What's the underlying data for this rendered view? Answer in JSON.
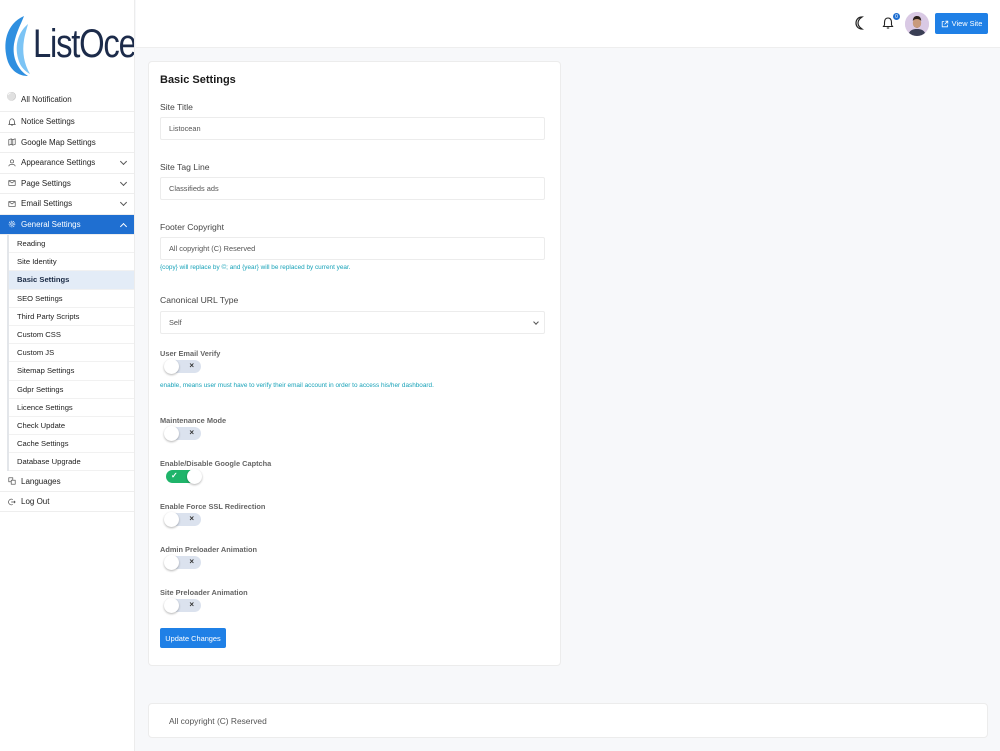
{
  "brand": {
    "name": "ListOcean"
  },
  "sidebar": {
    "items": [
      {
        "label": "All Notification",
        "icon": "bell-icon"
      },
      {
        "label": "Notice Settings",
        "icon": "bell-icon"
      },
      {
        "label": "Google Map Settings",
        "icon": "map-icon"
      },
      {
        "label": "Appearance Settings",
        "icon": "people-icon"
      },
      {
        "label": "Page Settings",
        "icon": "mail-icon"
      },
      {
        "label": "Email Settings",
        "icon": "mail-icon"
      },
      {
        "label": "General Settings",
        "icon": "gear-icon"
      }
    ],
    "submenu": [
      "Reading",
      "Site Identity",
      "Basic Settings",
      "SEO Settings",
      "Third Party Scripts",
      "Custom CSS",
      "Custom JS",
      "Sitemap Settings",
      "Gdpr Settings",
      "Licence Settings",
      "Check Update",
      "Cache Settings",
      "Database Upgrade"
    ],
    "bottom": [
      {
        "label": "Languages",
        "icon": "language-icon"
      },
      {
        "label": "Log Out",
        "icon": "logout-icon"
      }
    ]
  },
  "topbar": {
    "notification_count": "0",
    "view_site_label": "View Site"
  },
  "card": {
    "title": "Basic Settings",
    "site_title_label": "Site Title",
    "site_title_value": "Listocean",
    "tag_line_label": "Site Tag Line",
    "tag_line_value": "Classifieds ads",
    "footer_copyright_label": "Footer Copyright",
    "footer_copyright_value": "All copyright (C) Reserved",
    "footer_copyright_help": "{copy} will replace by ©; and {year} will be replaced by current year.",
    "canonical_label": "Canonical URL Type",
    "canonical_value": "Self",
    "user_email_verify_label": "User Email Verify",
    "user_email_verify_help": "enable, means user must have to verify their email account in order to access his/her dashboard.",
    "maintenance_label": "Maintenance Mode",
    "captcha_label": "Enable/Disable Google Captcha",
    "ssl_label": "Enable Force SSL Redirection",
    "admin_preloader_label": "Admin Preloader Animation",
    "site_preloader_label": "Site Preloader Animation",
    "update_button": "Update Changes"
  },
  "toggles": {
    "user_email_verify": false,
    "maintenance": false,
    "captcha": true,
    "ssl": false,
    "admin_preloader": false,
    "site_preloader": false
  },
  "footer": {
    "text": "All copyright (C) Reserved"
  },
  "colors": {
    "primary": "#1f6fd1",
    "button": "#1f80e6",
    "toggle_on": "#1fb46a",
    "help_text": "#17a2b8"
  }
}
